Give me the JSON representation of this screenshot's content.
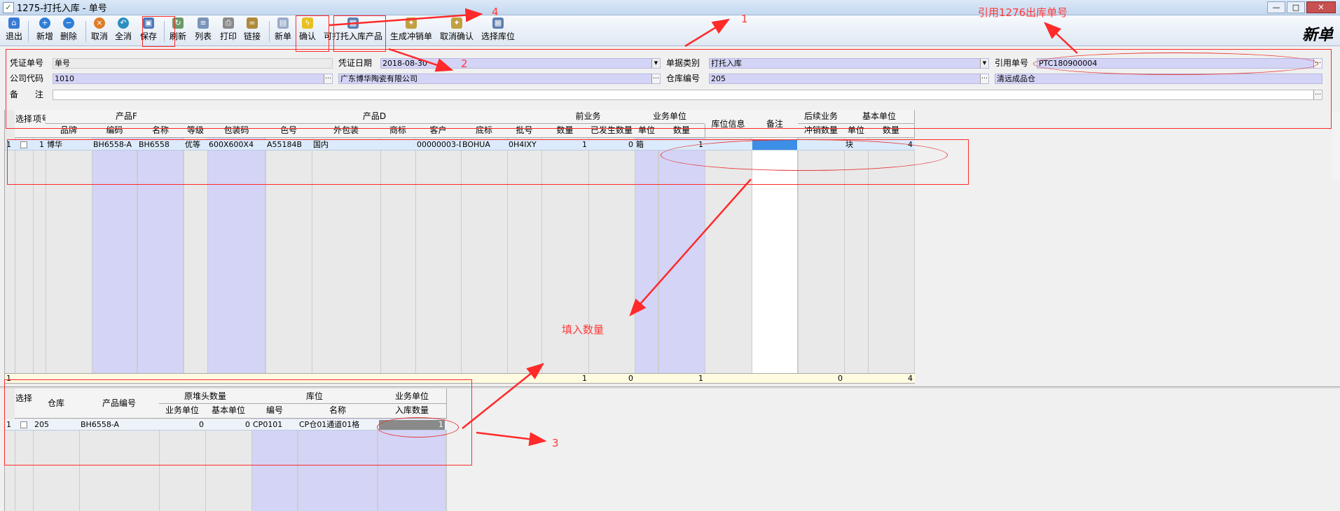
{
  "window": {
    "title": "1275-打托入库 - 单号",
    "buttons": [
      "—",
      "□",
      "✕"
    ]
  },
  "toolbar": {
    "items": [
      "退出",
      "新增",
      "删除",
      "取消",
      "全消",
      "保存",
      "刷新",
      "列表",
      "打印",
      "链接",
      "新单",
      "确认",
      "可打托入库产品",
      "生成冲销单",
      "取消确认",
      "选择库位"
    ],
    "mode_label": "新单"
  },
  "form": {
    "voucher_no": {
      "label": "凭证单号",
      "value": "单号"
    },
    "voucher_date": {
      "label": "凭证日期",
      "value": "2018-08-30"
    },
    "doc_type": {
      "label": "单据类别",
      "value": "打托入库"
    },
    "ref_no": {
      "label": "引用单号",
      "value": "PTC180900004"
    },
    "company": {
      "label": "公司代码",
      "code": "1010",
      "name": "广东博华陶瓷有限公司"
    },
    "warehouse": {
      "label": "仓库编号",
      "code": "205",
      "name": "清远成品仓"
    },
    "remark": {
      "label": "备 注",
      "value": ""
    }
  },
  "grid_main": {
    "group_headers": [
      "产品F",
      "产品D",
      "前业务",
      "业务单位",
      "库位信息",
      "备注",
      "后续业务",
      "基本单位"
    ],
    "headers": [
      "选择",
      "项号",
      "品牌",
      "编码",
      "名称",
      "等级",
      "包装码",
      "色号",
      "外包装",
      "商标",
      "客户",
      "底标",
      "批号",
      "数量",
      "已发生数量",
      "单位",
      "数量",
      "冲销数量",
      "单位",
      "数量"
    ],
    "row": {
      "rowno": "1",
      "item": "1",
      "brand": "博华",
      "code": "BH6558-A",
      "name": "BH6558",
      "grade": "优等",
      "pack": "600X600X4",
      "color": "A55184B",
      "outer": "国内",
      "trademark": "",
      "customer": "00000003-D",
      "bottom": "BOHUA",
      "batch": "0H4IXY",
      "prev_qty": "1",
      "done_qty": "0",
      "unit": "箱",
      "qty": "1",
      "offset_qty": "",
      "base_unit": "块",
      "base_qty": "4"
    },
    "footer": {
      "count": "1",
      "prev_qty": "1",
      "done_qty": "0",
      "qty": "1",
      "offset_qty": "0",
      "base_qty": "4"
    }
  },
  "grid_sub": {
    "group_headers": [
      "原堆头数量",
      "库位",
      "业务单位"
    ],
    "headers": [
      "选择",
      "仓库",
      "产品编号",
      "业务单位",
      "基本单位",
      "编号",
      "名称",
      "入库数量"
    ],
    "row": {
      "rowno": "1",
      "wh": "205",
      "code": "BH6558-A",
      "biz": "0",
      "base": "0",
      "loc_code": "CP0101",
      "loc_name": "CP仓01通道01格",
      "in_qty": "1"
    }
  },
  "annotations": {
    "n1": "1",
    "n2": "2",
    "n3": "3",
    "n4": "4",
    "ref_hint": "引用1276出库单号",
    "qty_hint": "填入数量"
  },
  "colors": {
    "annotation": "#ff2a2a",
    "lilac": "#d4d4f7"
  }
}
